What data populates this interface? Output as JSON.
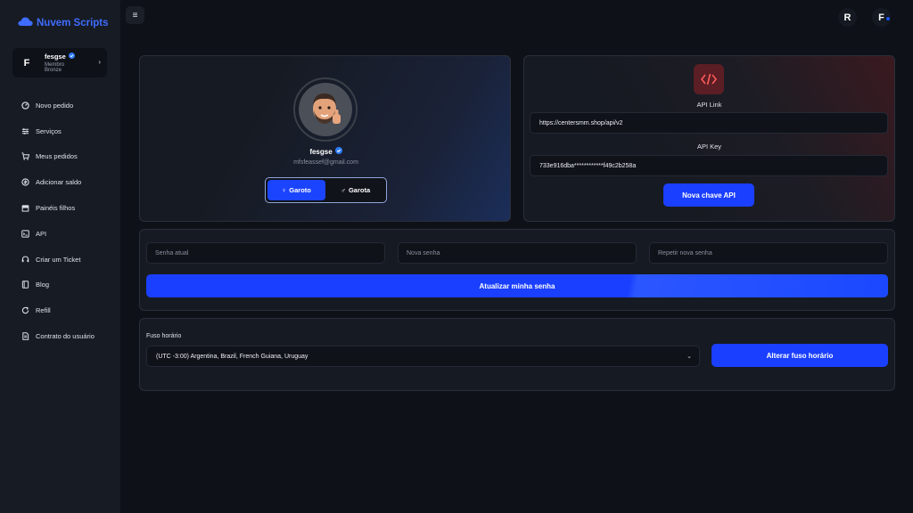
{
  "brand": {
    "name": "Nuvem Scripts",
    "color": "#3f6dff"
  },
  "user": {
    "initial": "F",
    "name": "fesgse",
    "level": "Membro Bronze",
    "verified": true
  },
  "sidebar": {
    "items": [
      {
        "label": "Novo pedido",
        "icon": "gauge-icon"
      },
      {
        "label": "Serviços",
        "icon": "sliders-icon"
      },
      {
        "label": "Meus pedidos",
        "icon": "cart-icon"
      },
      {
        "label": "Adicionar saldo",
        "icon": "coin-icon"
      },
      {
        "label": "Painéis filhos",
        "icon": "storefront-icon"
      },
      {
        "label": "API",
        "icon": "terminal-icon"
      },
      {
        "label": "Criar um Ticket",
        "icon": "headset-icon"
      },
      {
        "label": "Blog",
        "icon": "book-icon"
      },
      {
        "label": "Refill",
        "icon": "refresh-icon"
      },
      {
        "label": "Contrato do usuário",
        "icon": "document-icon"
      }
    ]
  },
  "topbar": {
    "menu_icon": "≡",
    "avatar_r": "R",
    "avatar_f": "F"
  },
  "profile": {
    "name": "fesgse",
    "email": "mfsfeassef@gmail.com",
    "gender_male": "Garoto",
    "gender_female": "Garota",
    "selected": "Garoto"
  },
  "api": {
    "link_label": "API Link",
    "link_value": "https://centersmm.shop/api/v2",
    "key_label": "API Key",
    "key_value": "733e916dba************f49c2b258a",
    "new_key_button": "Nova chave API",
    "accent": "#c0392b"
  },
  "password": {
    "current_placeholder": "Senha atual",
    "new_placeholder": "Nova senha",
    "repeat_placeholder": "Repetir nova senha",
    "update_button": "Atualizar minha senha"
  },
  "timezone": {
    "label": "Fuso horário",
    "selected": "(UTC -3:00) Argentina, Brazil, French Guiana, Uruguay",
    "button": "Alterar fuso horário"
  },
  "colors": {
    "primary": "#1b3fff",
    "background": "#0e1118",
    "sidebar": "#171b24"
  }
}
